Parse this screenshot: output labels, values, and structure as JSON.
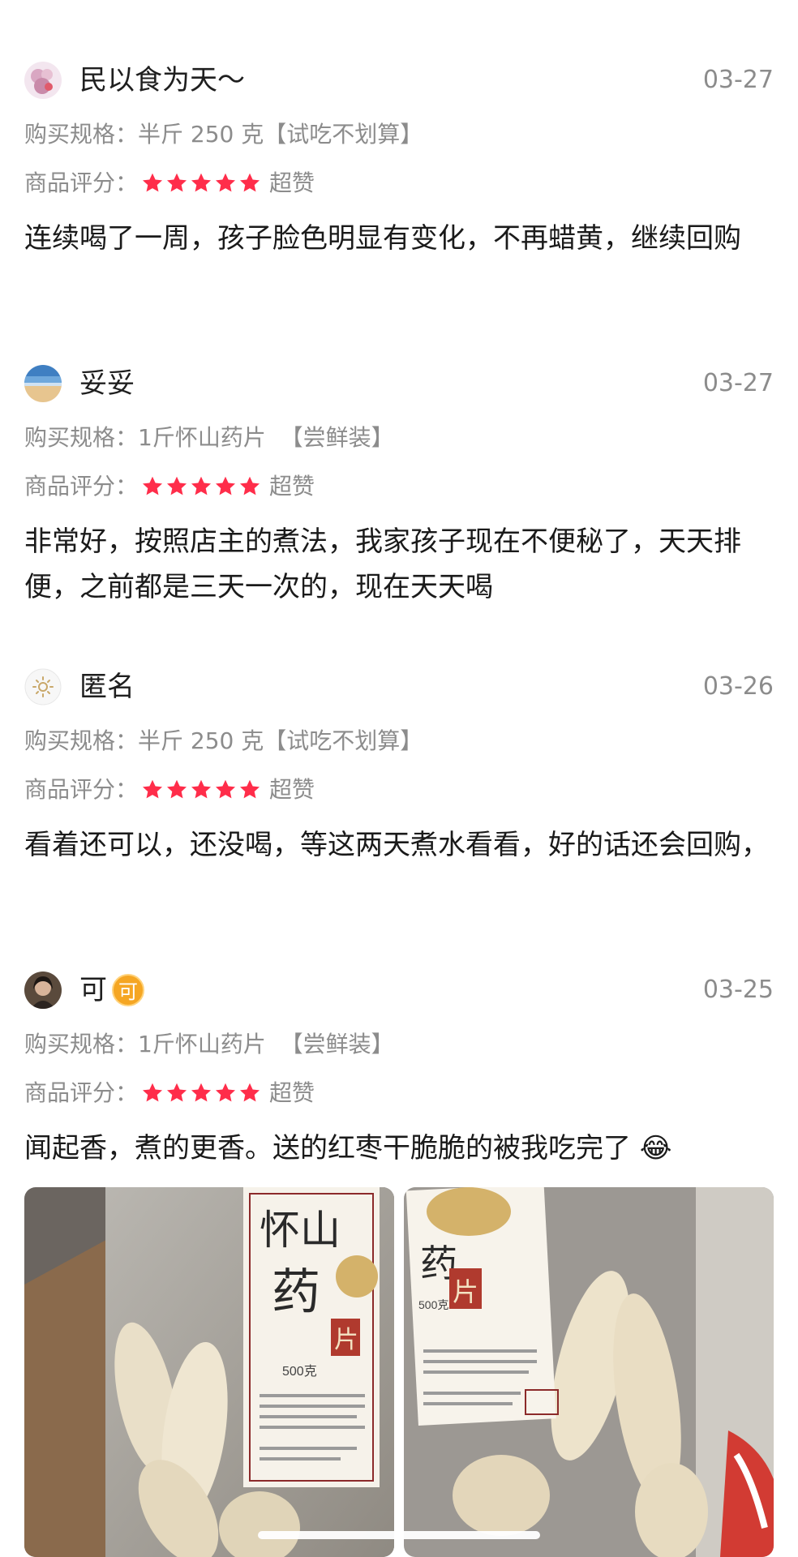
{
  "reviews": [
    {
      "username": "民以食为天～",
      "date": "03-27",
      "spec_label": "购买规格：",
      "spec_value": "半斤 250 克【试吃不划算】",
      "rating_label": "商品评分：",
      "rating_stars": 5,
      "rating_text": "超赞",
      "content": "连续喝了一周，孩子脸色明显有变化，不再蜡黄，继续回购"
    },
    {
      "username": "妥妥",
      "date": "03-27",
      "spec_label": "购买规格：",
      "spec_value": "1斤怀山药片  【尝鲜装】",
      "rating_label": "商品评分：",
      "rating_stars": 5,
      "rating_text": "超赞",
      "content": "非常好，按照店主的煮法，我家孩子现在不便秘了，天天排便，之前都是三天一次的，现在天天喝"
    },
    {
      "username": "匿名",
      "date": "03-26",
      "spec_label": "购买规格：",
      "spec_value": "半斤 250 克【试吃不划算】",
      "rating_label": "商品评分：",
      "rating_stars": 5,
      "rating_text": "超赞",
      "content": "看着还可以，还没喝，等这两天煮水看看，好的话还会回购，"
    },
    {
      "username": "可",
      "badge": "可",
      "date": "03-25",
      "spec_label": "购买规格：",
      "spec_value": "1斤怀山药片  【尝鲜装】",
      "rating_label": "商品评分：",
      "rating_stars": 5,
      "rating_text": "超赞",
      "content": "闻起香，煮的更香。送的红枣干脆脆的被我吃完了 😂"
    }
  ],
  "photo_labels": {
    "left": {
      "line1": "怀山",
      "line2": "药",
      "stamp": "片",
      "weight": "500克"
    },
    "right": {
      "line1": "药",
      "stamp": "片",
      "weight": "500克"
    }
  },
  "colors": {
    "star": "#ff2d4a",
    "meta_text": "#8c8c8c",
    "body_text": "#1a1a1a"
  }
}
